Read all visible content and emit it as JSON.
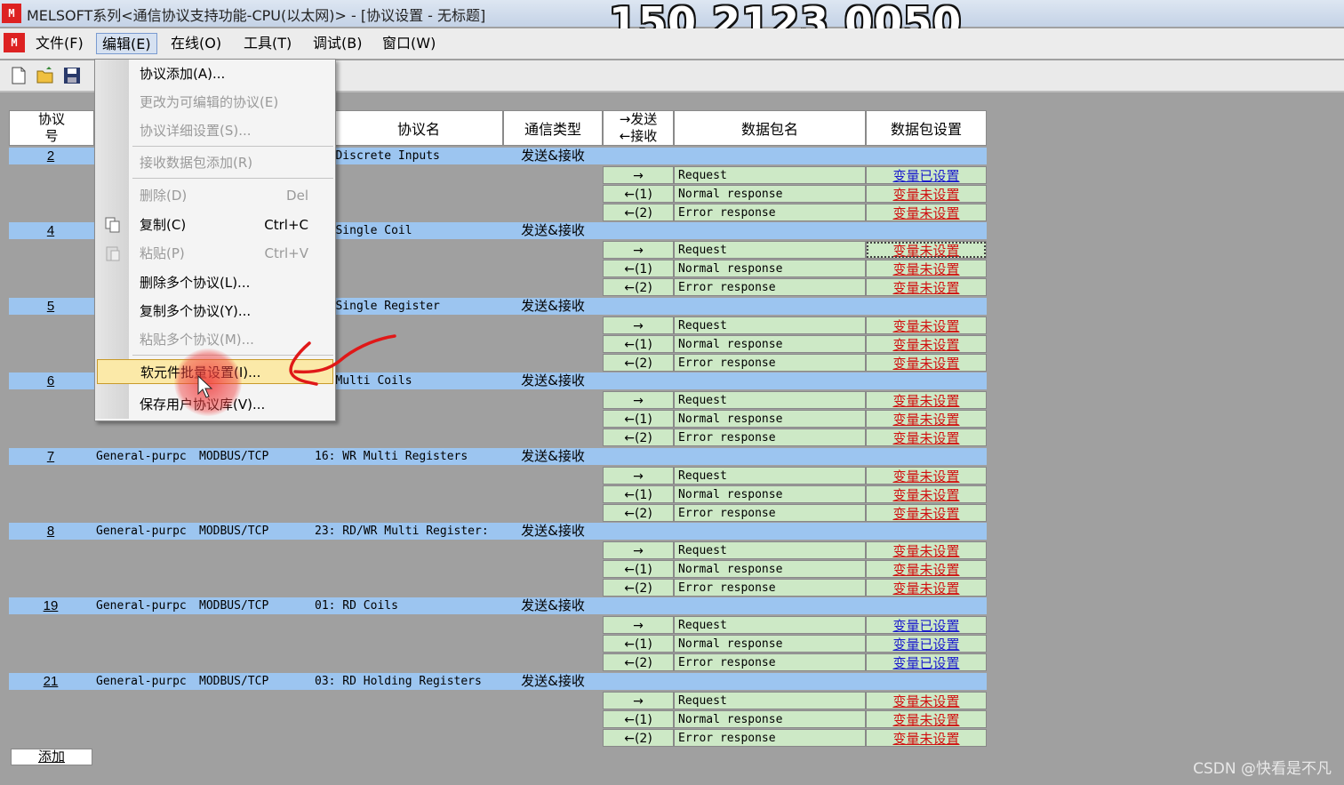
{
  "window": {
    "title": "MELSOFT系列<通信协议支持功能-CPU(以太网)> - [协议设置 - 无标题]",
    "overlay_phone": "150 2123 0050"
  },
  "menubar": [
    {
      "label": "文件(F)"
    },
    {
      "label": "编辑(E)"
    },
    {
      "label": "在线(O)"
    },
    {
      "label": "工具(T)"
    },
    {
      "label": "调试(B)"
    },
    {
      "label": "窗口(W)"
    }
  ],
  "edit_menu": {
    "items": [
      {
        "label": "协议添加(A)...",
        "shortcut": "",
        "enabled": true
      },
      {
        "label": "更改为可编辑的协议(E)",
        "shortcut": "",
        "enabled": false
      },
      {
        "label": "协议详细设置(S)...",
        "shortcut": "",
        "enabled": false
      },
      {
        "label": "接收数据包添加(R)",
        "shortcut": "",
        "enabled": false
      },
      {
        "label": "删除(D)",
        "shortcut": "Del",
        "enabled": false
      },
      {
        "label": "复制(C)",
        "shortcut": "Ctrl+C",
        "enabled": true
      },
      {
        "label": "粘贴(P)",
        "shortcut": "Ctrl+V",
        "enabled": false
      },
      {
        "label": "删除多个协议(L)...",
        "shortcut": "",
        "enabled": true
      },
      {
        "label": "复制多个协议(Y)...",
        "shortcut": "",
        "enabled": true
      },
      {
        "label": "粘贴多个协议(M)...",
        "shortcut": "",
        "enabled": false
      },
      {
        "label": "软元件批量设置(I)...",
        "shortcut": "",
        "enabled": true,
        "highlighted": true
      },
      {
        "label": "保存用户协议库(V)...",
        "shortcut": "",
        "enabled": true
      }
    ]
  },
  "table": {
    "headers": {
      "protocol_no": [
        "协议",
        "号"
      ],
      "protocol_name": "协议名",
      "comm_type": "通信类型",
      "send": "→发送",
      "recv": "←接收",
      "packet_name": "数据包名",
      "packet_settings": "数据包设置"
    },
    "rows": [
      {
        "num": "2",
        "category": "",
        "manufacturer": "",
        "name": "RD Discrete Inputs",
        "type": "发送&接收",
        "packets": [
          {
            "dir": "→",
            "name": "Request",
            "setting": "变量已设置",
            "state": "done"
          },
          {
            "dir": "←(1)",
            "name": "Normal response",
            "setting": "变量未设置",
            "state": "todo"
          },
          {
            "dir": "←(2)",
            "name": "Error response",
            "setting": "变量未设置",
            "state": "todo"
          }
        ]
      },
      {
        "num": "4",
        "category": "",
        "manufacturer": "",
        "name": "WR Single Coil",
        "type": "发送&接收",
        "packets": [
          {
            "dir": "→",
            "name": "Request",
            "setting": "变量未设置",
            "state": "todo",
            "focused": true
          },
          {
            "dir": "←(1)",
            "name": "Normal response",
            "setting": "变量未设置",
            "state": "todo"
          },
          {
            "dir": "←(2)",
            "name": "Error response",
            "setting": "变量未设置",
            "state": "todo"
          }
        ]
      },
      {
        "num": "5",
        "category": "",
        "manufacturer": "",
        "name": "WR Single Register",
        "type": "发送&接收",
        "packets": [
          {
            "dir": "→",
            "name": "Request",
            "setting": "变量未设置",
            "state": "todo"
          },
          {
            "dir": "←(1)",
            "name": "Normal response",
            "setting": "变量未设置",
            "state": "todo"
          },
          {
            "dir": "←(2)",
            "name": "Error response",
            "setting": "变量未设置",
            "state": "todo"
          }
        ]
      },
      {
        "num": "6",
        "category": "",
        "manufacturer": "",
        "name": "WR Multi Coils",
        "type": "发送&接收",
        "packets": [
          {
            "dir": "→",
            "name": "Request",
            "setting": "变量未设置",
            "state": "todo"
          },
          {
            "dir": "←(1)",
            "name": "Normal response",
            "setting": "变量未设置",
            "state": "todo"
          },
          {
            "dir": "←(2)",
            "name": "Error response",
            "setting": "变量未设置",
            "state": "todo"
          }
        ]
      },
      {
        "num": "7",
        "category": "General-purpc",
        "manufacturer": "MODBUS/TCP",
        "name": "16: WR Multi Registers",
        "type": "发送&接收",
        "packets": [
          {
            "dir": "→",
            "name": "Request",
            "setting": "变量未设置",
            "state": "todo"
          },
          {
            "dir": "←(1)",
            "name": "Normal response",
            "setting": "变量未设置",
            "state": "todo"
          },
          {
            "dir": "←(2)",
            "name": "Error response",
            "setting": "变量未设置",
            "state": "todo"
          }
        ]
      },
      {
        "num": "8",
        "category": "General-purpc",
        "manufacturer": "MODBUS/TCP",
        "name": "23: RD/WR Multi Register:",
        "type": "发送&接收",
        "packets": [
          {
            "dir": "→",
            "name": "Request",
            "setting": "变量未设置",
            "state": "todo"
          },
          {
            "dir": "←(1)",
            "name": "Normal response",
            "setting": "变量未设置",
            "state": "todo"
          },
          {
            "dir": "←(2)",
            "name": "Error response",
            "setting": "变量未设置",
            "state": "todo"
          }
        ]
      },
      {
        "num": "19",
        "category": "General-purpc",
        "manufacturer": "MODBUS/TCP",
        "name": "01: RD Coils",
        "type": "发送&接收",
        "packets": [
          {
            "dir": "→",
            "name": "Request",
            "setting": "变量已设置",
            "state": "done"
          },
          {
            "dir": "←(1)",
            "name": "Normal response",
            "setting": "变量已设置",
            "state": "done"
          },
          {
            "dir": "←(2)",
            "name": "Error response",
            "setting": "变量已设置",
            "state": "done"
          }
        ]
      },
      {
        "num": "21",
        "category": "General-purpc",
        "manufacturer": "MODBUS/TCP",
        "name": "03: RD Holding Registers",
        "type": "发送&接收",
        "packets": [
          {
            "dir": "→",
            "name": "Request",
            "setting": "变量未设置",
            "state": "todo"
          },
          {
            "dir": "←(1)",
            "name": "Normal response",
            "setting": "变量未设置",
            "state": "todo"
          },
          {
            "dir": "←(2)",
            "name": "Error response",
            "setting": "变量未设置",
            "state": "todo"
          }
        ]
      }
    ],
    "add_label": "添加"
  },
  "watermark": "CSDN @快看是不凡",
  "colors": {
    "row_band": "#9cc5f0",
    "packet_row": "#cde9c6",
    "set_done": "#1a1acc",
    "set_todo": "#d01010",
    "menu_highlight": "#fbe9a8"
  }
}
